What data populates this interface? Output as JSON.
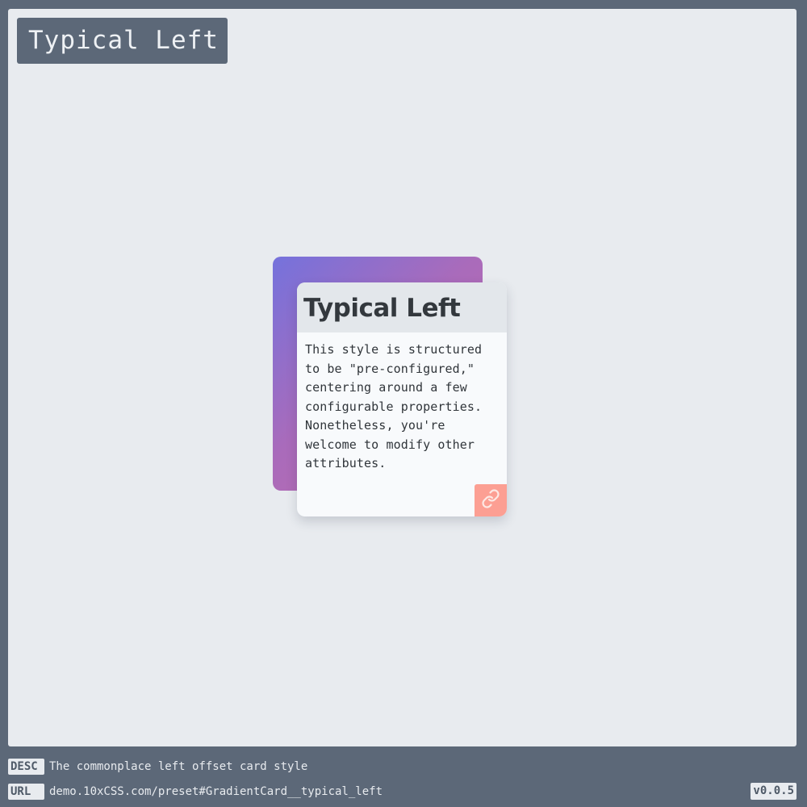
{
  "page": {
    "title": "Typical Left"
  },
  "card": {
    "title": "Typical Left",
    "body": "This style is structured to be \"pre-configured,\" centering around a few configurable properties. Nonetheless, you're welcome to modify other attributes.",
    "link_icon": "link-icon",
    "gradient_start": "#7572dc",
    "gradient_end": "#c66aa7",
    "accent": "#fc9f93"
  },
  "footer": {
    "desc_label": "DESC",
    "desc_text": "The commonplace left offset card style",
    "url_label": "URL",
    "url_text": "demo.10xCSS.com/preset#GradientCard__typical_left",
    "version": "v0.0.5"
  },
  "colors": {
    "frame": "#5c6878",
    "stage": "#e8ebef"
  }
}
